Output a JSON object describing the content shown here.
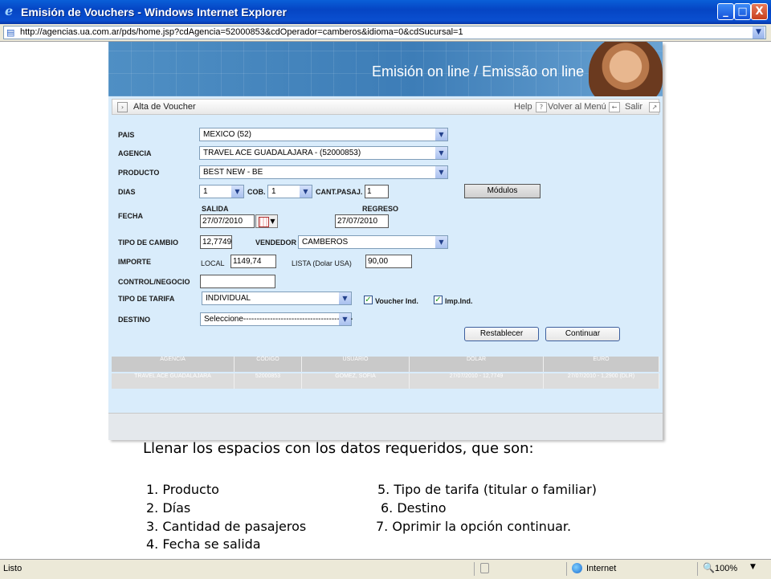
{
  "window": {
    "title": "Emisión de Vouchers - Windows Internet Explorer",
    "minimize": "_",
    "maximize": "□",
    "close": "X"
  },
  "address": {
    "url": "http://agencias.ua.com.ar/pds/home.jsp?cdAgencia=52000853&cdOperador=camberos&idioma=0&cdSucursal=1"
  },
  "banner": {
    "title": "Emisión on line / Emissão on line"
  },
  "toolbar": {
    "section": "Alta de Voucher",
    "help": "Help",
    "back": "Volver al Menú",
    "exit": "Salir"
  },
  "form": {
    "pais": {
      "label": "PAIS",
      "value": "MEXICO (52)"
    },
    "agencia": {
      "label": "AGENCIA",
      "value": "TRAVEL ACE GUADALAJARA - (52000853)"
    },
    "producto": {
      "label": "PRODUCTO",
      "value": "BEST NEW - BE"
    },
    "dias": {
      "label": "DIAS",
      "value": "1"
    },
    "cob": {
      "label": "COB.",
      "value": "1"
    },
    "pasaj": {
      "label": "CANT.PASAJ.",
      "value": "1"
    },
    "modulos": "Módulos",
    "fecha": {
      "label": "FECHA",
      "salida_label": "SALIDA",
      "salida": "27/07/2010",
      "regreso_label": "REGRESO",
      "regreso": "27/07/2010"
    },
    "cambio": {
      "label": "TIPO DE CAMBIO",
      "value": "12,7749"
    },
    "vendedor": {
      "label": "VENDEDOR",
      "value": "CAMBEROS"
    },
    "importe": {
      "label": "IMPORTE",
      "local_label": "LOCAL",
      "local": "1149,74",
      "lista_label": "LISTA (Dolar USA)",
      "lista": "90,00"
    },
    "control": {
      "label": "CONTROL/NEGOCIO",
      "value": ""
    },
    "tarifa": {
      "label": "TIPO DE TARIFA",
      "value": "INDIVIDUAL",
      "voucher_ind": "Voucher Ind.",
      "imp_ind": "Imp.Ind."
    },
    "destino": {
      "label": "DESTINO",
      "value": "Seleccione-----------------------------------------"
    },
    "restablecer": "Restablecer",
    "continuar": "Continuar"
  },
  "info_table": {
    "headers": [
      "AGENCIA",
      "CÓDIGO",
      "USUARIO",
      "DOLAR",
      "EURO"
    ],
    "row": [
      "TRAVEL ACE GUADALAJARA",
      "52000853",
      "GOMEZ, SOFIA",
      "27/07/2010 - 12,7749",
      "27/07/2010 - 1,2900 (DLR)"
    ]
  },
  "instructions": {
    "heading": "Llenar los espacios con los datos requeridos, que son:",
    "items": [
      "1.   Producto",
      "2.   Días",
      "3.   Cantidad de pasajeros",
      "4.   Fecha se salida",
      "5.  Tipo de tarifa (titular o familiar)",
      "6. Destino",
      "7.  Oprimir la opción continuar."
    ]
  },
  "status": {
    "text": "Listo",
    "zone": "Internet",
    "zoom": "100%"
  }
}
